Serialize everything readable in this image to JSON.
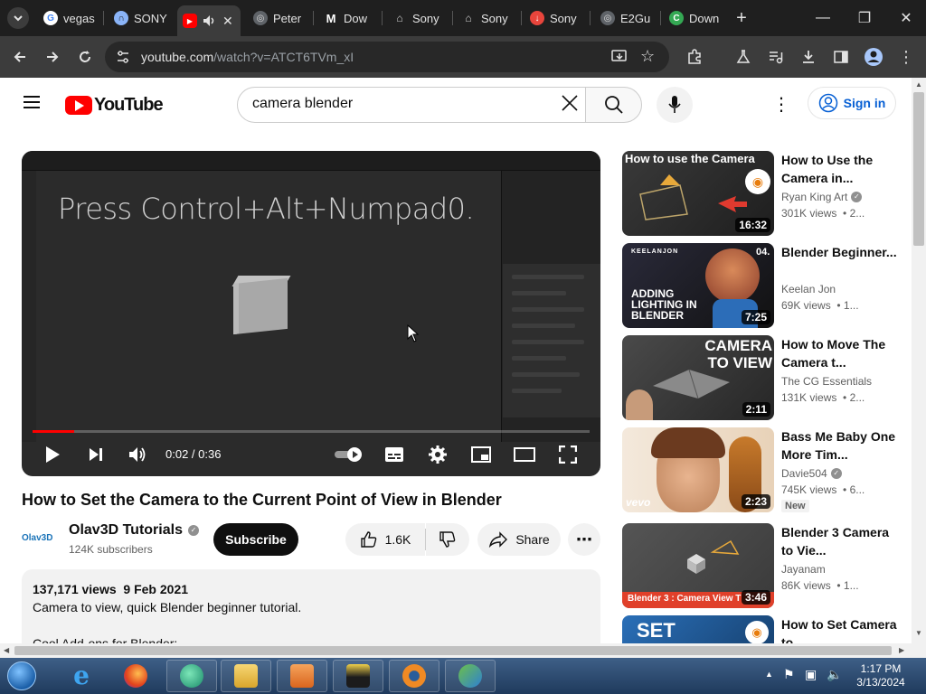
{
  "browser": {
    "tabs": [
      {
        "label": "vegas",
        "icon": "google-icon",
        "color": "#4285f4"
      },
      {
        "label": "SONY",
        "icon": "headset-icon",
        "color": "#8ab4f8"
      },
      {
        "label": "",
        "icon": "youtube-icon",
        "color": "#ff0000",
        "active": true
      },
      {
        "label": "Peter",
        "icon": "globe-icon",
        "color": "#9aa0a6"
      },
      {
        "label": "Dow",
        "icon": "m-icon",
        "color": "#ffffff"
      },
      {
        "label": "Sony",
        "icon": "bank-icon",
        "color": "#cfcfcf"
      },
      {
        "label": "Sony",
        "icon": "bank-icon",
        "color": "#cfcfcf"
      },
      {
        "label": "Sony",
        "icon": "download-circle-icon",
        "color": "#e8453c"
      },
      {
        "label": "E2Gu",
        "icon": "globe-icon",
        "color": "#9aa0a6"
      },
      {
        "label": "Down",
        "icon": "c-icon",
        "color": "#34a853"
      }
    ],
    "url_host": "youtube.com",
    "url_path": "/watch?v=ATCT6TVm_xI"
  },
  "masthead": {
    "logo_text": "YouTube",
    "search_value": "camera blender",
    "signin_label": "Sign in"
  },
  "player": {
    "overlay_text": "Press Control+Alt+Numpad0.",
    "time": "0:02 / 0:36",
    "progress": 0.075
  },
  "video": {
    "title": "How to Set the Camera to the Current Point of View in Blender",
    "channel_avatar": "Olav3D",
    "channel": "Olav3D Tutorials",
    "subscribers": "124K subscribers",
    "subscribe_label": "Subscribe",
    "likes": "1.6K",
    "share_label": "Share",
    "views_date": "137,171 views  9 Feb 2021",
    "description": "Camera to view, quick Blender beginner tutorial.",
    "description_2": "Cool Add-ons for Blender:"
  },
  "recommendations": [
    {
      "title": "How to Use the Camera in...",
      "channel": "Ryan King Art",
      "verified": true,
      "views": "301K views  • 2...",
      "duration": "16:32",
      "thumb_text": "How to use the Camera"
    },
    {
      "title": "Blender Beginner...",
      "channel": "Keelan Jon",
      "verified": false,
      "views": "69K views  • 1...",
      "duration": "7:25",
      "thumb_text": "ADDING LIGHTING IN BLENDER",
      "thumb_tag": "KEELANJON",
      "thumb_num": "04."
    },
    {
      "title": "How to Move The Camera t...",
      "channel": "The CG Essentials",
      "verified": false,
      "views": "131K views  • 2...",
      "duration": "2:11",
      "thumb_text": "CAMERA TO VIEW"
    },
    {
      "title": "Bass Me Baby One More Tim...",
      "channel": "Davie504",
      "verified": true,
      "views": "745K views  • 6...",
      "duration": "2:23",
      "badge": "New",
      "thumb_text": "vevo"
    },
    {
      "title": "Blender 3 Camera to Vie...",
      "channel": "Jayanam",
      "verified": false,
      "views": "86K views  • 1...",
      "duration": "3:46",
      "thumb_text": "Blender 3 : Camera View T"
    },
    {
      "title": "How to Set Camera to...",
      "channel": "",
      "verified": false,
      "views": "",
      "duration": "",
      "thumb_text": "SET"
    }
  ],
  "taskbar": {
    "time": "1:17 PM",
    "date": "3/13/2024"
  }
}
